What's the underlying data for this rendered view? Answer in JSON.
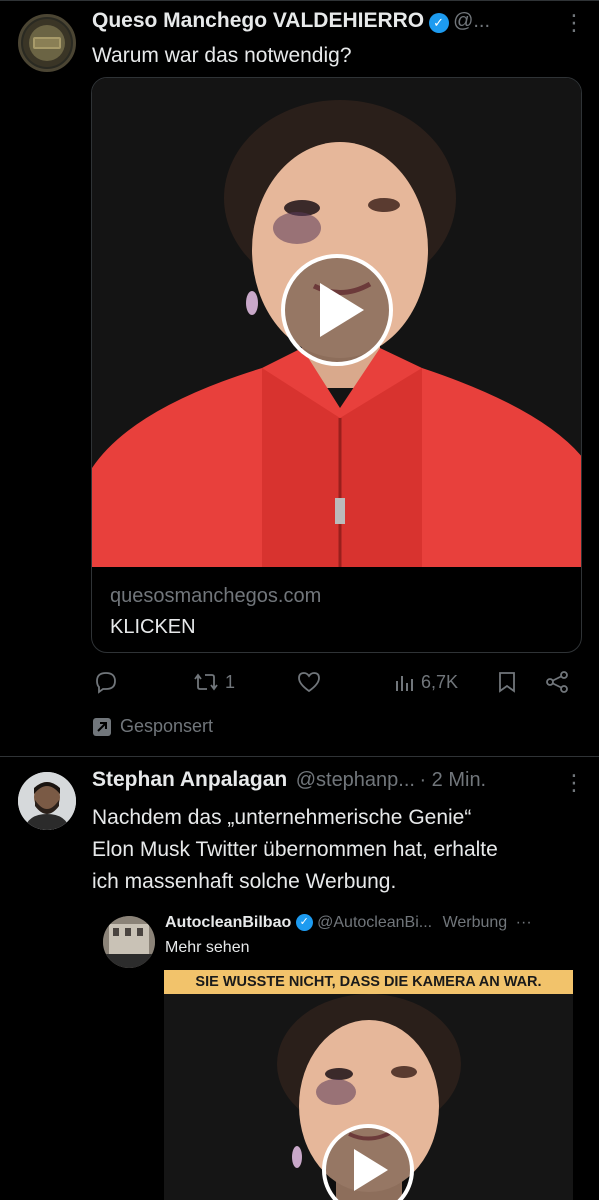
{
  "post1": {
    "author_name": "Queso Manchego VALDEHIERRO",
    "handle": "@...",
    "text": "Warum war das notwendig?",
    "card_domain": "quesosmanchegos.com",
    "card_cta": "KLICKEN",
    "retweets": "1",
    "views": "6,7K",
    "sponsored_label": "Gesponsert"
  },
  "post2": {
    "author_name": "Stephan Anpalagan",
    "handle": "@stephanp...",
    "time": "· 2 Min.",
    "text_line1": "Nachdem das „unternehmerische Genie“",
    "text_line2": "Elon Musk Twitter übernommen hat, erhalte",
    "text_line3": "ich massenhaft solche Werbung."
  },
  "embedded": {
    "author_name": "AutocleanBilbao",
    "handle": "@AutocleanBi...",
    "ad_label": "Werbung",
    "more_link": "Mehr sehen",
    "banner_text": "SIE WUSSTE NICHT, DASS DIE KAMERA AN WAR."
  },
  "colors": {
    "background": "#000000",
    "verified": "#1d9bf0",
    "muted": "#71767b",
    "jacket_red": "#e8403c",
    "banner_yellow": "#f2c36b"
  },
  "icons": [
    "verified-badge-icon",
    "more-icon",
    "play-icon",
    "reply-icon",
    "retweet-icon",
    "like-icon",
    "views-icon",
    "bookmark-icon",
    "share-icon",
    "sponsored-arrow-icon"
  ]
}
